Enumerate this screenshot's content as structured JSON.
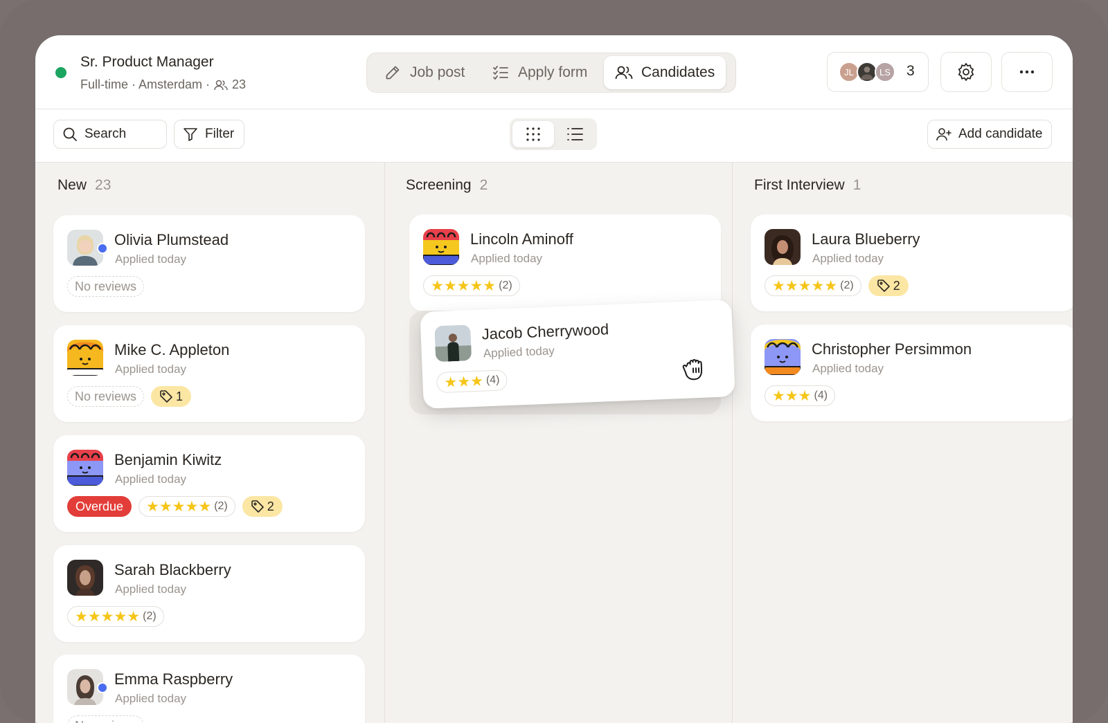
{
  "colors": {
    "status_dot": "#1aa560",
    "overdue": "#e23d38",
    "tag_bg": "#fbe6a4",
    "star": "#f5c518",
    "new_indicator": "#4a6cf0"
  },
  "header": {
    "job_title": "Sr. Product Manager",
    "job_meta": "Full-time · Amsterdam ·",
    "candidate_count": "23",
    "tabs": [
      {
        "label": "Job post",
        "icon": "pencil-icon"
      },
      {
        "label": "Apply form",
        "icon": "checklist-icon"
      },
      {
        "label": "Candidates",
        "icon": "users-icon",
        "active": true
      }
    ],
    "team": {
      "initials": [
        "JL",
        "",
        "LS"
      ],
      "count": "3"
    },
    "settings_icon": "gear-icon",
    "more_icon": "more-dots-icon"
  },
  "toolbar": {
    "search_label": "Search",
    "filter_label": "Filter",
    "view_modes": [
      "grid-dots-icon",
      "list-icon"
    ],
    "add_candidate_label": "Add candidate"
  },
  "columns": [
    {
      "title": "New",
      "count": "23",
      "cards": [
        {
          "name": "Olivia Plumstead",
          "sub": "Applied today",
          "no_reviews": "No reviews",
          "is_new": true
        },
        {
          "name": "Mike C. Appleton",
          "sub": "Applied today",
          "no_reviews": "No reviews",
          "tags": "1"
        },
        {
          "name": "Benjamin Kiwitz",
          "sub": "Applied today",
          "overdue": "Overdue",
          "stars": "★★★★★",
          "reviews": "(2)",
          "tags": "2"
        },
        {
          "name": "Sarah Blackberry",
          "sub": "Applied today",
          "stars": "★★★★★",
          "reviews": "(2)"
        },
        {
          "name": "Emma Raspberry",
          "sub": "Applied today",
          "no_reviews": "No reviews",
          "is_new": true
        }
      ]
    },
    {
      "title": "Screening",
      "count": "2",
      "cards": [
        {
          "name": "Lincoln Aminoff",
          "sub": "Applied today",
          "stars": "★★★★★",
          "reviews": "(2)"
        },
        {
          "name": "Jacob Cherrywood",
          "sub": "Applied today",
          "stars": "★★★",
          "reviews": "(4)",
          "dragging": true
        }
      ]
    },
    {
      "title": "First Interview",
      "count": "1",
      "cards": [
        {
          "name": "Laura Blueberry",
          "sub": "Applied today",
          "stars": "★★★★★",
          "reviews": "(2)",
          "tags": "2"
        },
        {
          "name": "Christopher Persimmon",
          "sub": "Applied today",
          "stars": "★★★",
          "reviews": "(4)"
        }
      ]
    }
  ]
}
